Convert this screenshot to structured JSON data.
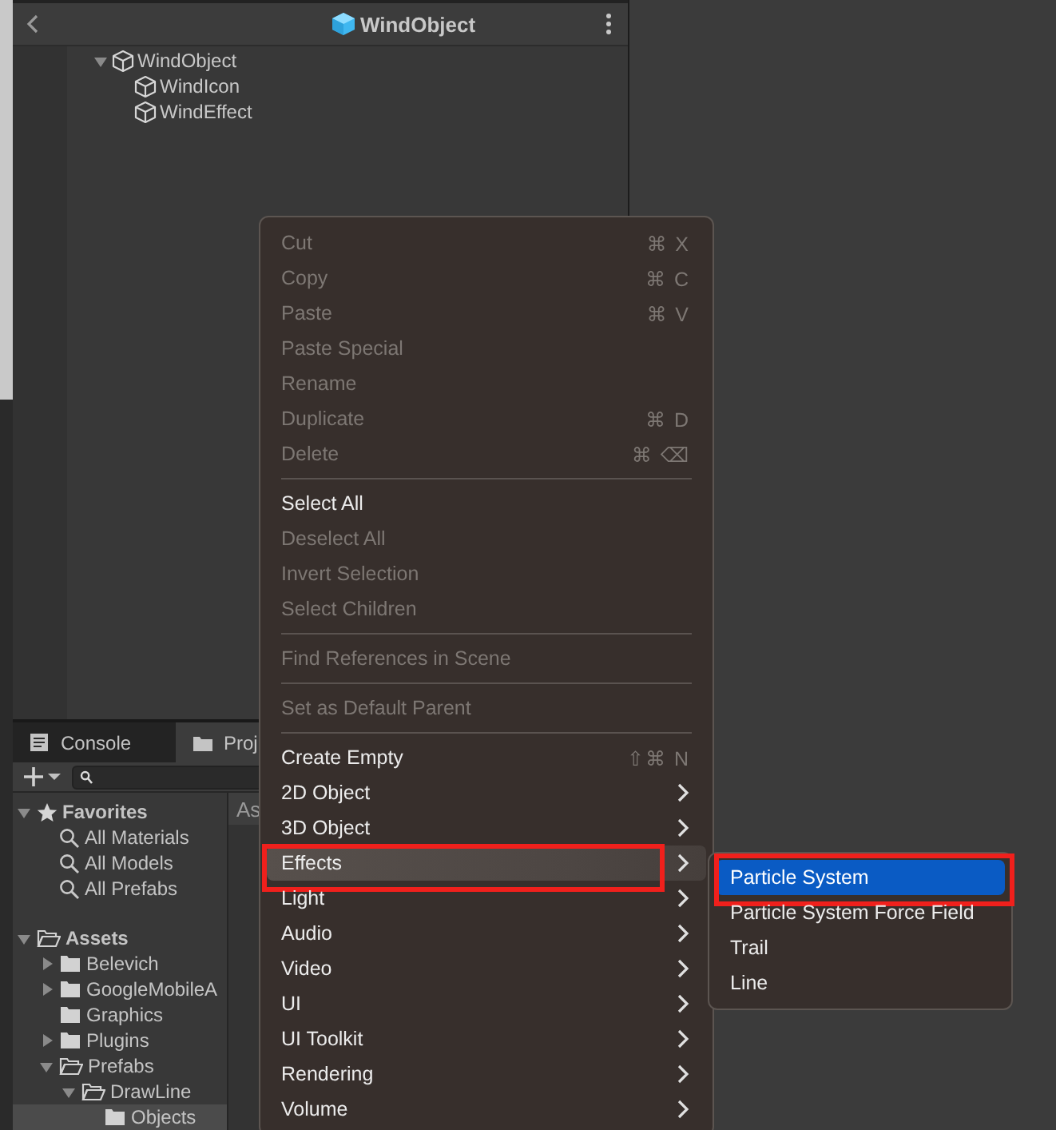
{
  "hierarchy": {
    "title": "WindObject",
    "tree": [
      {
        "label": "WindObject",
        "expanded": true,
        "selected": false,
        "children": [
          {
            "label": "WindIcon",
            "selected": false
          },
          {
            "label": "WindEffect",
            "selected": false
          }
        ]
      }
    ]
  },
  "bottom_panel": {
    "tabs": [
      {
        "label": "Console",
        "kind": "console",
        "selected": false
      },
      {
        "label": "Proj",
        "kind": "project",
        "selected": true
      }
    ],
    "project_tree": [
      {
        "label": "Favorites",
        "kind": "favorites",
        "expanded": true,
        "selected": false,
        "children": [
          {
            "label": "All Materials",
            "kind": "search",
            "selected": false
          },
          {
            "label": "All Models",
            "kind": "search",
            "selected": false
          },
          {
            "label": "All Prefabs",
            "kind": "search",
            "selected": false
          }
        ]
      },
      {
        "label": "Assets",
        "kind": "folder",
        "expanded": true,
        "selected": false,
        "children": [
          {
            "label": "Belevich",
            "kind": "folder",
            "expanded": false,
            "selected": false
          },
          {
            "label": "GoogleMobileA",
            "kind": "folder",
            "expanded": false,
            "selected": false
          },
          {
            "label": "Graphics",
            "kind": "folder",
            "selected": false
          },
          {
            "label": "Plugins",
            "kind": "folder",
            "expanded": false,
            "selected": false
          },
          {
            "label": "Prefabs",
            "kind": "folder",
            "expanded": true,
            "selected": false,
            "children": [
              {
                "label": "DrawLine",
                "kind": "folder",
                "expanded": true,
                "selected": false,
                "children": [
                  {
                    "label": "Objects",
                    "kind": "folder",
                    "selected": true
                  }
                ]
              }
            ]
          }
        ]
      }
    ],
    "assets_header": "As"
  },
  "context_menu": {
    "items": [
      {
        "kind": "item",
        "label": "Cut",
        "shortcut": "⌘ X",
        "disabled": true
      },
      {
        "kind": "item",
        "label": "Copy",
        "shortcut": "⌘ C",
        "disabled": true
      },
      {
        "kind": "item",
        "label": "Paste",
        "shortcut": "⌘ V",
        "disabled": true
      },
      {
        "kind": "item",
        "label": "Paste Special",
        "disabled": true
      },
      {
        "kind": "item",
        "label": "Rename",
        "disabled": true
      },
      {
        "kind": "item",
        "label": "Duplicate",
        "shortcut": "⌘ D",
        "disabled": true
      },
      {
        "kind": "item",
        "label": "Delete",
        "shortcut": "⌘ ⌫",
        "disabled": true
      },
      {
        "kind": "separator"
      },
      {
        "kind": "item",
        "label": "Select All",
        "disabled": false
      },
      {
        "kind": "item",
        "label": "Deselect All",
        "disabled": true
      },
      {
        "kind": "item",
        "label": "Invert Selection",
        "disabled": true
      },
      {
        "kind": "item",
        "label": "Select Children",
        "disabled": true
      },
      {
        "kind": "separator"
      },
      {
        "kind": "item",
        "label": "Find References in Scene",
        "disabled": true
      },
      {
        "kind": "separator"
      },
      {
        "kind": "item",
        "label": "Set as Default Parent",
        "disabled": true
      },
      {
        "kind": "separator"
      },
      {
        "kind": "item",
        "label": "Create Empty",
        "shortcut": "⇧⌘ N",
        "disabled": false
      },
      {
        "kind": "item",
        "label": "2D Object",
        "disabled": false,
        "submenu": true
      },
      {
        "kind": "item",
        "label": "3D Object",
        "disabled": false,
        "submenu": true
      },
      {
        "kind": "item",
        "label": "Effects",
        "disabled": false,
        "submenu": true,
        "selected": true,
        "highlighted": true
      },
      {
        "kind": "item",
        "label": "Light",
        "disabled": false,
        "submenu": true
      },
      {
        "kind": "item",
        "label": "Audio",
        "disabled": false,
        "submenu": true
      },
      {
        "kind": "item",
        "label": "Video",
        "disabled": false,
        "submenu": true
      },
      {
        "kind": "item",
        "label": "UI",
        "disabled": false,
        "submenu": true
      },
      {
        "kind": "item",
        "label": "UI Toolkit",
        "disabled": false,
        "submenu": true
      },
      {
        "kind": "item",
        "label": "Rendering",
        "disabled": false,
        "submenu": true
      },
      {
        "kind": "item",
        "label": "Volume",
        "disabled": false,
        "submenu": true
      }
    ]
  },
  "submenu": {
    "items": [
      {
        "label": "Particle System",
        "selected": true,
        "highlighted": true
      },
      {
        "label": "Particle System Force Field",
        "selected": false
      },
      {
        "label": "Trail",
        "selected": false
      },
      {
        "label": "Line",
        "selected": false
      }
    ]
  }
}
